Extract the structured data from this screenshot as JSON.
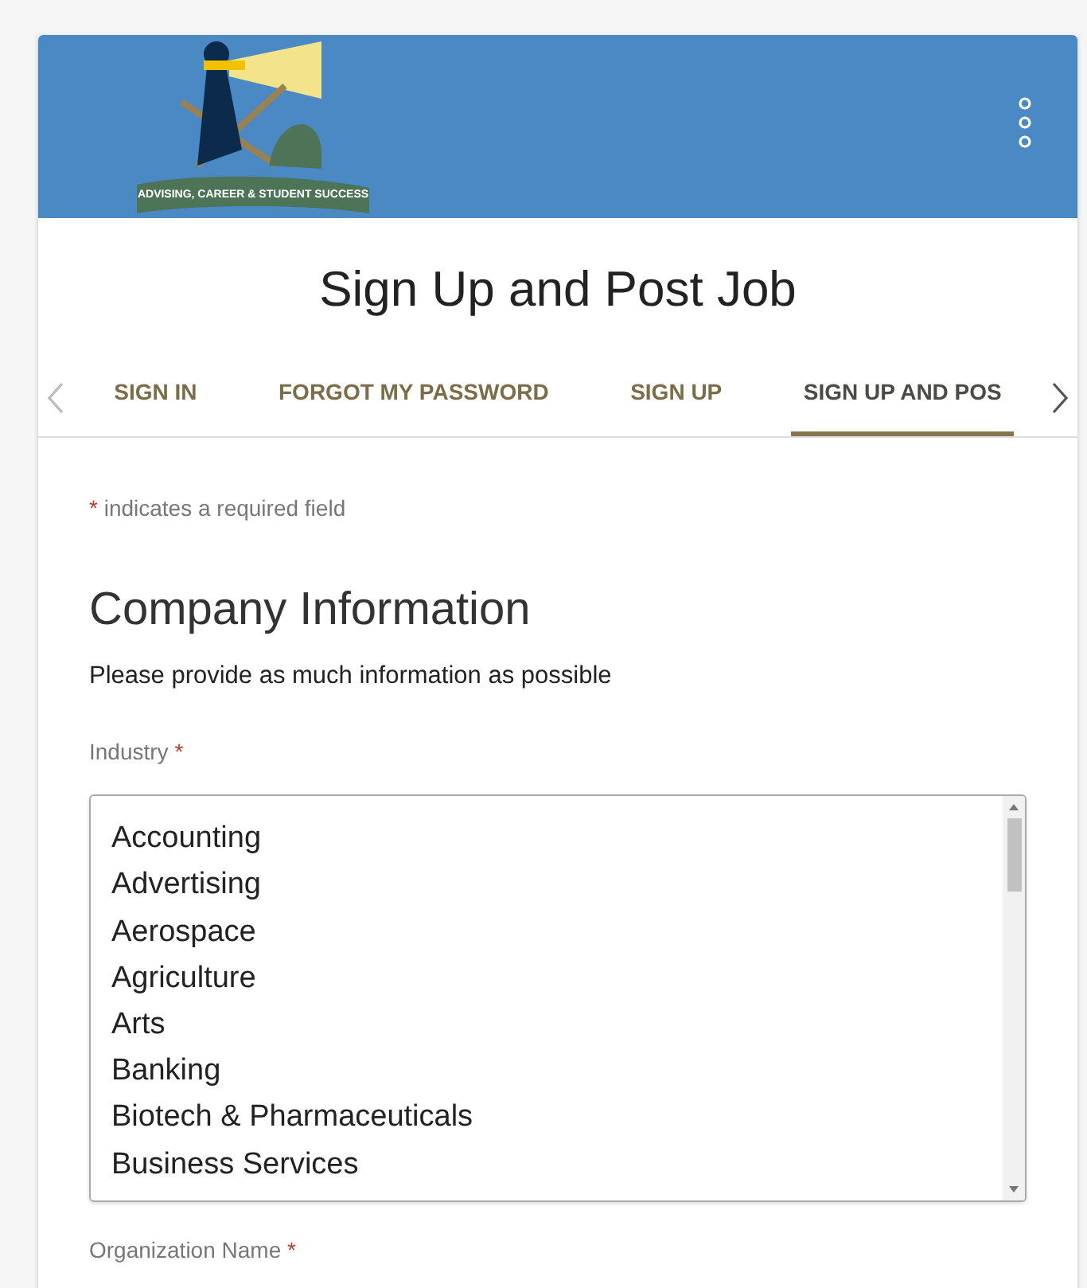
{
  "header": {
    "logo_text": "ADVISING, CAREER & STUDENT SUCCESS"
  },
  "title": "Sign Up and Post Job",
  "tabs": [
    {
      "label": "SIGN IN",
      "selected": false
    },
    {
      "label": "FORGOT MY PASSWORD",
      "selected": false
    },
    {
      "label": "SIGN UP",
      "selected": false
    },
    {
      "label": "SIGN UP AND POS",
      "selected": true
    }
  ],
  "required_note": {
    "mark": "*",
    "text": "indicates a required field"
  },
  "section_title": "Company Information",
  "section_intro": "Please provide as much information as possible",
  "fields": [
    {
      "kind": "listbox",
      "label": "Industry",
      "required_mark": "*",
      "options": [
        "Accounting",
        "Advertising",
        "Aerospace",
        "Agriculture",
        "Arts",
        "Banking",
        "Biotech & Pharmaceuticals",
        "Business Services"
      ]
    },
    {
      "kind": "label",
      "label": "Organization Name",
      "required_mark": "*"
    }
  ]
}
